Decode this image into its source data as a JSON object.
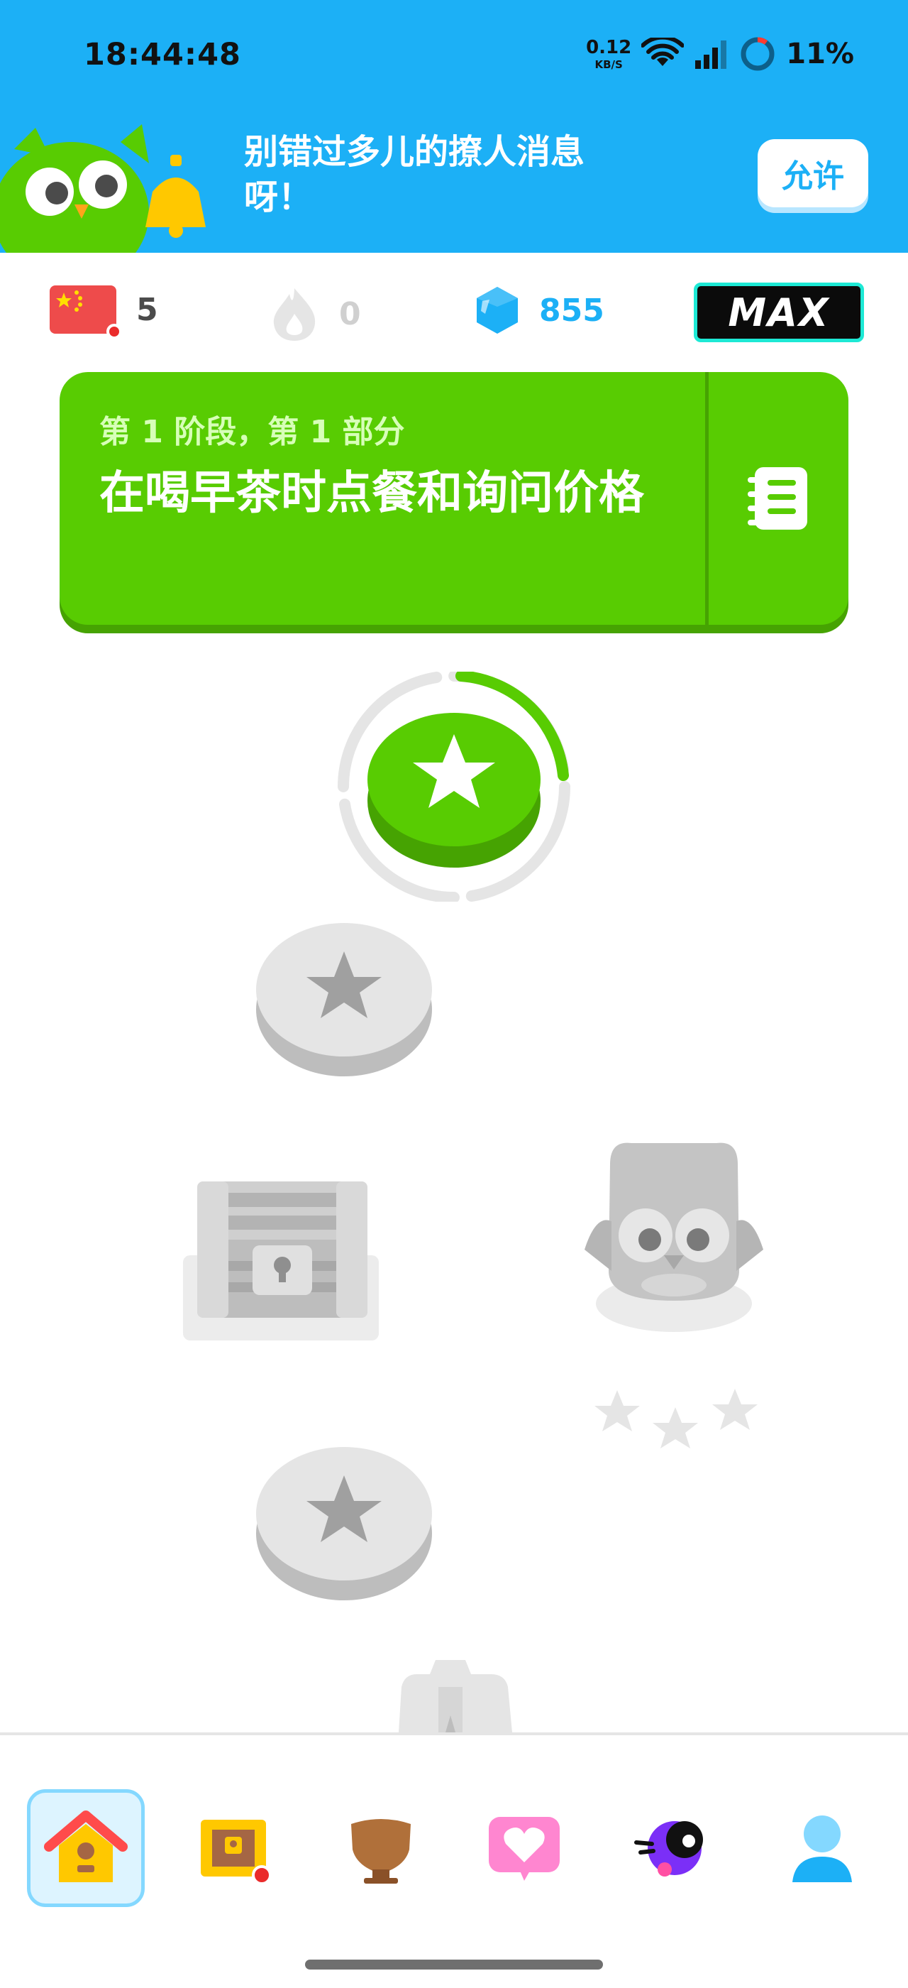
{
  "status_bar": {
    "time": "18:44:48",
    "net_speed": "0.12",
    "net_unit": "KB/S",
    "battery": "11%",
    "icons": [
      "wifi-icon",
      "signal-icon",
      "battery-ring-icon"
    ]
  },
  "banner": {
    "text": "别错过多儿的撩人消息呀！",
    "allow_button": "允许",
    "mascot": "owl-with-bell"
  },
  "stats": {
    "language_flag": "china-flag",
    "language_count": "5",
    "streak_count": "0",
    "gems_count": "855",
    "subscription_badge": "MAX"
  },
  "unit": {
    "subtitle": "第 1 阶段，第 1 部分",
    "title": "在喝早茶时点餐和询问价格",
    "guide_icon": "notebook-icon"
  },
  "path": {
    "nodes": [
      {
        "type": "lesson",
        "state": "active",
        "icon": "star-icon"
      },
      {
        "type": "lesson",
        "state": "locked",
        "icon": "star-icon"
      },
      {
        "type": "chest",
        "state": "locked",
        "icon": "treasure-chest-icon"
      },
      {
        "type": "lesson",
        "state": "locked",
        "icon": "star-icon"
      },
      {
        "type": "trophy",
        "state": "locked",
        "icon": "trophy-icon"
      }
    ],
    "active_progress": 0.33
  },
  "nav": {
    "items": [
      {
        "name": "learn",
        "icon": "home-icon",
        "active": true
      },
      {
        "name": "chest",
        "icon": "treasure-chest-icon",
        "has_badge": true
      },
      {
        "name": "league",
        "icon": "shield-icon"
      },
      {
        "name": "friends",
        "icon": "heart-bubble-icon"
      },
      {
        "name": "max",
        "icon": "max-character-icon"
      },
      {
        "name": "profile",
        "icon": "profile-icon"
      }
    ]
  },
  "colors": {
    "brand_blue": "#1cb0f6",
    "brand_green": "#58cc02",
    "gem_blue": "#1cb0f6",
    "locked_gray": "#e5e5e5"
  }
}
